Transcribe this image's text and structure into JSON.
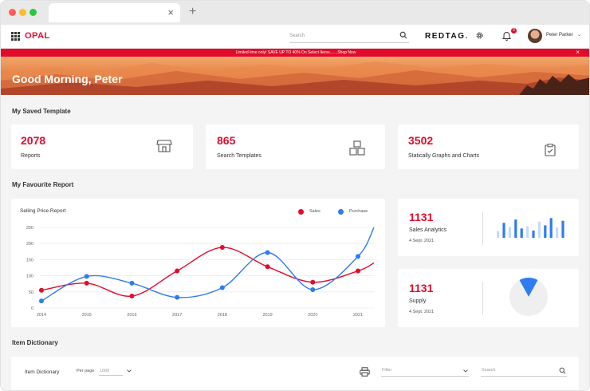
{
  "browser": {
    "tab_close": "×",
    "new_tab": "+"
  },
  "header": {
    "logo": "OPAL",
    "search_placeholder": "Search",
    "brand_main": "REDTAG",
    "brand_dot": ".",
    "notification_count": "0",
    "user_name": "Peter Parker",
    "user_caret": "⌄"
  },
  "promo": {
    "text": "Limited time only! SAVE UP TO 40% On Select Items.......Shop Now",
    "close": "×"
  },
  "hero": {
    "greeting": "Good Morning, Peter"
  },
  "saved_templates": {
    "title": "My Saved Template",
    "cards": [
      {
        "value": "2078",
        "label": "Reports",
        "icon": "store-icon"
      },
      {
        "value": "865",
        "label": "Search Templates",
        "icon": "boxes-icon"
      },
      {
        "value": "3502",
        "label": "Statically Graphs and Charts",
        "icon": "clipboard-check-icon"
      }
    ]
  },
  "favourite": {
    "title": "My Favourite Report",
    "sales_analytics": {
      "value": "1131",
      "label": "Sales Analytics",
      "date": "4 Sept. 2021"
    },
    "supply": {
      "value": "1131",
      "label": "Supply",
      "date": "4 Sept. 2021"
    }
  },
  "chart_data": [
    {
      "type": "line",
      "title": "Selling Price Report",
      "x": [
        "2014",
        "2015",
        "2016",
        "2017",
        "2018",
        "2019",
        "2020",
        "2021"
      ],
      "yticks": [
        "0",
        "50",
        "100",
        "150",
        "200",
        "250"
      ],
      "ylim": [
        0,
        250
      ],
      "grid": true,
      "legend": "top-right",
      "series": [
        {
          "name": "Sales",
          "color": "#e30b2c",
          "values": [
            55,
            77,
            37,
            115,
            188,
            128,
            80,
            115
          ],
          "end_value": 140
        },
        {
          "name": "Purchase",
          "color": "#2f7bf1",
          "values": [
            22,
            98,
            77,
            33,
            63,
            172,
            57,
            160
          ],
          "end_value": 250
        }
      ]
    },
    {
      "type": "bar",
      "values": [
        0.32,
        0.72,
        0.52,
        0.88,
        0.45,
        0.55,
        0.35,
        0.78,
        0.6,
        0.95,
        0.5,
        0.82
      ],
      "colors": [
        "#c8d9fb",
        "#2f7bf1",
        "#c8d9fb",
        "#2f7bf1",
        "#2f7bf1",
        "#c8d9fb",
        "#2f7bf1",
        "#c8d9fb",
        "#2f7bf1",
        "#2f7bf1",
        "#c8d9fb",
        "#2f7bf1"
      ]
    },
    {
      "type": "pie",
      "values": [
        0.16,
        0.84
      ],
      "colors": [
        "#2f7bf1",
        "#efefef"
      ]
    }
  ],
  "item_dictionary": {
    "section_title": "Item Dictionary",
    "toolbar_title": "Item Dictionary",
    "per_page_label": "Per page",
    "per_page_value": "1000",
    "filter_placeholder": "Filter",
    "search_placeholder": "Search"
  }
}
